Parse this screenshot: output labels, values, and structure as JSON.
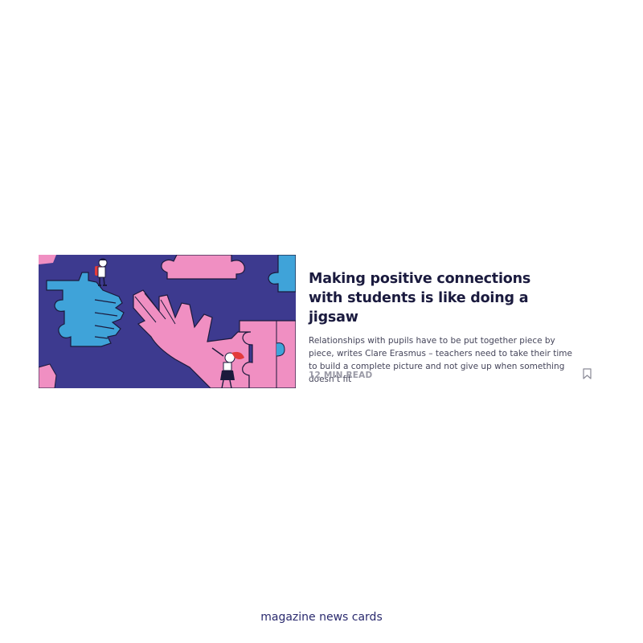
{
  "card": {
    "image_alt": "Illustration of puzzle-piece hands connecting, with small figures of a teacher and a student",
    "title": "Making positive connections with students is like doing a jigsaw",
    "summary": "Relationships with pupils have to be put together piece by piece, writes Clare Erasmus – teachers need to take their time to build a complete picture and not give up when something doesn’t fit",
    "read_time": "12 MIN READ",
    "bookmark_icon": "bookmark-icon"
  },
  "caption": "magazine news cards",
  "colors": {
    "illustration_bg": "#3d3a8f",
    "puzzle_pink": "#f08fc2",
    "puzzle_blue": "#3fa3d9",
    "title": "#1a1a3e",
    "meta": "#9a9aa6",
    "caption": "#2a2a6e"
  }
}
